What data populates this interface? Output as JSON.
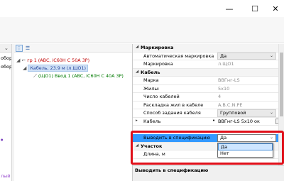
{
  "window": {
    "minimize_glyph": "—",
    "maximize_glyph": "☐",
    "close_glyph": "✕"
  },
  "left_panel": {
    "row1": "обор",
    "row2": "обор",
    "row3": "лый"
  },
  "tree": {
    "toolbar": [
      "tree-view-icon",
      "list-view-icon"
    ],
    "nodes": {
      "n1": "гр 1 (ABC, iC60H C 50A 3P)",
      "n2": "Кабель, 23.9 м (л.ЩО1)",
      "n3": "(ЩО1) Ввод 1 (ABC, iC60H C 40A 3P)"
    }
  },
  "grid": {
    "cat1": "Маркировка",
    "auto_mark": {
      "name": "Автоматическая маркировка",
      "value": "Да"
    },
    "mark": {
      "name": "Маркировка",
      "value": "л.ЩО1"
    },
    "cat2": "Кабель",
    "brand": {
      "name": "Марка",
      "value": "ВВГнг-LS"
    },
    "cores": {
      "name": "Жилы:",
      "value": "5x10"
    },
    "count": {
      "name": "Число кабелей",
      "value": "4"
    },
    "layout": {
      "name": "Раскладка жил в кабеле",
      "value": "A.B.C.N.PE"
    },
    "method": {
      "name": "Способ задания кабеля",
      "value": "Групповой"
    },
    "cable": {
      "name": "Кабель",
      "value": "ВВГнг-LS 5x10 ок"
    },
    "spec": {
      "name": "Выводить в спецификацию",
      "value": "Да"
    },
    "cat3": "Участок",
    "length": {
      "name": "Длина, м"
    }
  },
  "dropdown": {
    "options": [
      "Да",
      "Нет"
    ]
  },
  "description": {
    "title": "Выводить в спецификацию"
  },
  "colors": {
    "highlight": "#e0101a",
    "selection": "#3399ff"
  }
}
